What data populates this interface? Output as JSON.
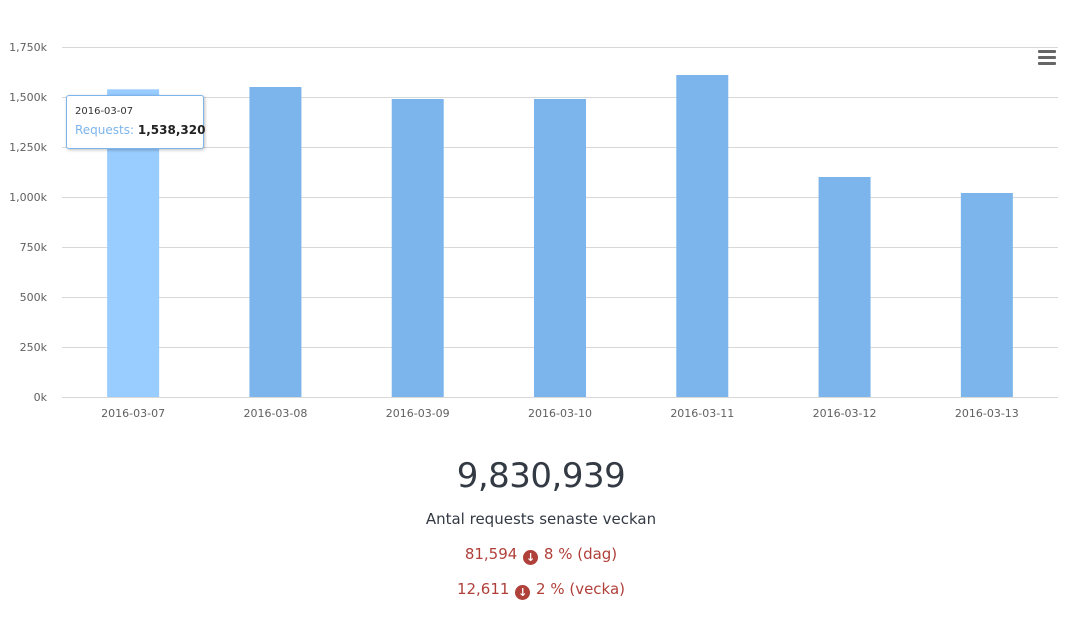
{
  "chart_data": {
    "type": "bar",
    "categories": [
      "2016-03-07",
      "2016-03-08",
      "2016-03-09",
      "2016-03-10",
      "2016-03-11",
      "2016-03-12",
      "2016-03-13"
    ],
    "series": [
      {
        "name": "Requests",
        "values": [
          1538320,
          1550000,
          1490000,
          1490000,
          1610000,
          1100000,
          1020000
        ]
      }
    ],
    "ylim": [
      0,
      1750000
    ],
    "yticks": [
      "0k",
      "250k",
      "500k",
      "750k",
      "1,000k",
      "1,250k",
      "1,500k",
      "1,750k"
    ],
    "grid": true,
    "colors": {
      "bar": "#7cb5ec",
      "bar_hover": "#99ccff"
    },
    "hovered_index": 0
  },
  "tooltip": {
    "date": "2016-03-07",
    "series_label": "Requests:",
    "value": "1,538,320"
  },
  "menu": {
    "icon": "hamburger-menu-icon"
  },
  "summary": {
    "total": "9,830,939",
    "caption": "Antal requests senaste veckan",
    "day_delta": "81,594",
    "day_change": "8 % (dag)",
    "week_delta": "12,611",
    "week_change": "2 % (vecka)",
    "down_icon": "arrow-down-circle-icon",
    "negative_color": "#b0403a"
  }
}
